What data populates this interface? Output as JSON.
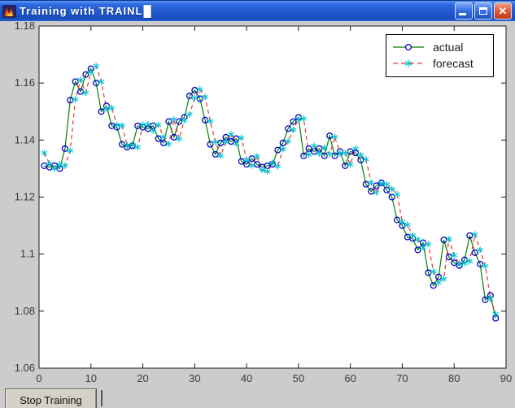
{
  "window": {
    "title": "Training with TRAINL",
    "title_block": "█",
    "icons": {
      "app": "matlab-flame-icon",
      "minimize": "minimize-bar",
      "maximize": "restore-square",
      "close": "✕"
    }
  },
  "footer": {
    "stop_button_label": "Stop Training"
  },
  "colors": {
    "titlebar_blue": "#2057cd",
    "figure_bg": "#cccccc",
    "plot_bg": "#ffffff",
    "axis": "#1a1a1a",
    "tick_label": "#3c3c3c",
    "close_red": "#d8542e"
  },
  "chart_data": {
    "type": "line",
    "title": "",
    "xlabel": "",
    "ylabel": "",
    "xlim": [
      0,
      90
    ],
    "ylim": [
      1.06,
      1.18
    ],
    "xticks": [
      0,
      10,
      20,
      30,
      40,
      50,
      60,
      70,
      80,
      90
    ],
    "yticks": [
      1.06,
      1.08,
      1.1,
      1.12,
      1.14,
      1.16,
      1.18
    ],
    "ytick_labels": [
      "1.06",
      "1.08",
      "1.1",
      "1.12",
      "1.14",
      "1.16",
      "1.18"
    ],
    "grid": false,
    "legend": {
      "position": "top-right",
      "entries": [
        "actual",
        "forecast"
      ]
    },
    "series": [
      {
        "name": "actual",
        "line_style": "solid",
        "color": "#008000",
        "marker": "circle",
        "marker_color": "#0000cd",
        "x_start": 1,
        "x_step": 1,
        "values": [
          1.131,
          1.1305,
          1.131,
          1.13,
          1.137,
          1.154,
          1.1605,
          1.157,
          1.163,
          1.165,
          1.16,
          1.15,
          1.152,
          1.145,
          1.1445,
          1.1385,
          1.1375,
          1.138,
          1.145,
          1.1445,
          1.144,
          1.145,
          1.1405,
          1.139,
          1.1465,
          1.141,
          1.1465,
          1.148,
          1.1555,
          1.1575,
          1.1545,
          1.147,
          1.1385,
          1.135,
          1.139,
          1.141,
          1.1395,
          1.1405,
          1.1325,
          1.1315,
          1.1335,
          1.1315,
          1.1305,
          1.131,
          1.1315,
          1.1365,
          1.139,
          1.144,
          1.1465,
          1.148,
          1.1345,
          1.137,
          1.136,
          1.137,
          1.1345,
          1.1415,
          1.1345,
          1.136,
          1.131,
          1.136,
          1.1355,
          1.133,
          1.1245,
          1.122,
          1.124,
          1.125,
          1.1225,
          1.12,
          1.112,
          1.11,
          1.106,
          1.1055,
          1.1015,
          1.104,
          1.0935,
          1.089,
          1.092,
          1.105,
          1.099,
          1.097,
          1.096,
          1.098,
          1.1065,
          1.1005,
          1.0965,
          1.084,
          1.0855,
          1.0775
        ]
      },
      {
        "name": "forecast",
        "line_style": "dashed",
        "color": "#e8392f",
        "marker": "asterisk",
        "marker_color": "#00c8d0",
        "x_start": 1,
        "x_step": 1,
        "values": [
          1.1355,
          1.1318,
          1.13,
          1.1314,
          1.131,
          1.1363,
          1.1543,
          1.1611,
          1.1566,
          1.1638,
          1.166,
          1.1604,
          1.151,
          1.1513,
          1.1453,
          1.1451,
          1.1381,
          1.1383,
          1.1375,
          1.1454,
          1.1455,
          1.1433,
          1.1453,
          1.1411,
          1.1386,
          1.1473,
          1.1405,
          1.1469,
          1.149,
          1.1548,
          1.1578,
          1.1551,
          1.1466,
          1.1393,
          1.1345,
          1.1394,
          1.142,
          1.1388,
          1.1408,
          1.1331,
          1.1311,
          1.1343,
          1.1295,
          1.129,
          1.132,
          1.1308,
          1.1368,
          1.1396,
          1.1436,
          1.1473,
          1.1475,
          1.1349,
          1.138,
          1.1353,
          1.1373,
          1.1351,
          1.1411,
          1.1353,
          1.1355,
          1.1314,
          1.137,
          1.1348,
          1.1333,
          1.1251,
          1.1216,
          1.1248,
          1.1245,
          1.1229,
          1.121,
          1.1113,
          1.1103,
          1.1066,
          1.1051,
          1.1023,
          1.1035,
          1.0939,
          1.09,
          1.0913,
          1.1053,
          1.0996,
          1.0966,
          1.0968,
          1.0975,
          1.1069,
          1.1015,
          1.0958,
          1.0843,
          1.079
        ]
      }
    ]
  }
}
